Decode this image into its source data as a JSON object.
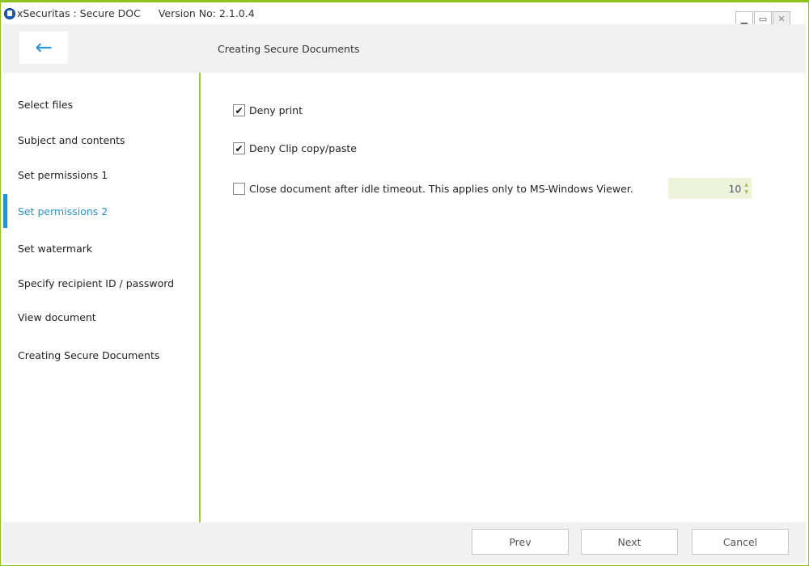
{
  "window": {
    "title": "xSecuritas : Secure DOC",
    "version": "Version No: 2.1.0.4",
    "border_color": "#8dc21f"
  },
  "header": {
    "title": "Creating Secure Documents"
  },
  "sidebar": {
    "items": [
      {
        "label": "Select files"
      },
      {
        "label": "Subject and contents"
      },
      {
        "label": "Set permissions 1"
      },
      {
        "label": "Set permissions 2",
        "active": true
      },
      {
        "label": "Set watermark"
      },
      {
        "label": "Specify recipient ID / password"
      },
      {
        "label": "View document"
      },
      {
        "label": "Creating Secure Documents"
      }
    ],
    "accent": "#2a8fd0"
  },
  "options": [
    {
      "label": "Deny print",
      "checked": true
    },
    {
      "label": "Deny Clip copy/paste",
      "checked": true
    },
    {
      "label": "Close document after idle timeout. This applies only to MS-Windows Viewer.",
      "checked": false
    }
  ],
  "timeout": {
    "value": "10"
  },
  "footer": {
    "prev": "Prev",
    "next": "Next",
    "cancel": "Cancel"
  }
}
